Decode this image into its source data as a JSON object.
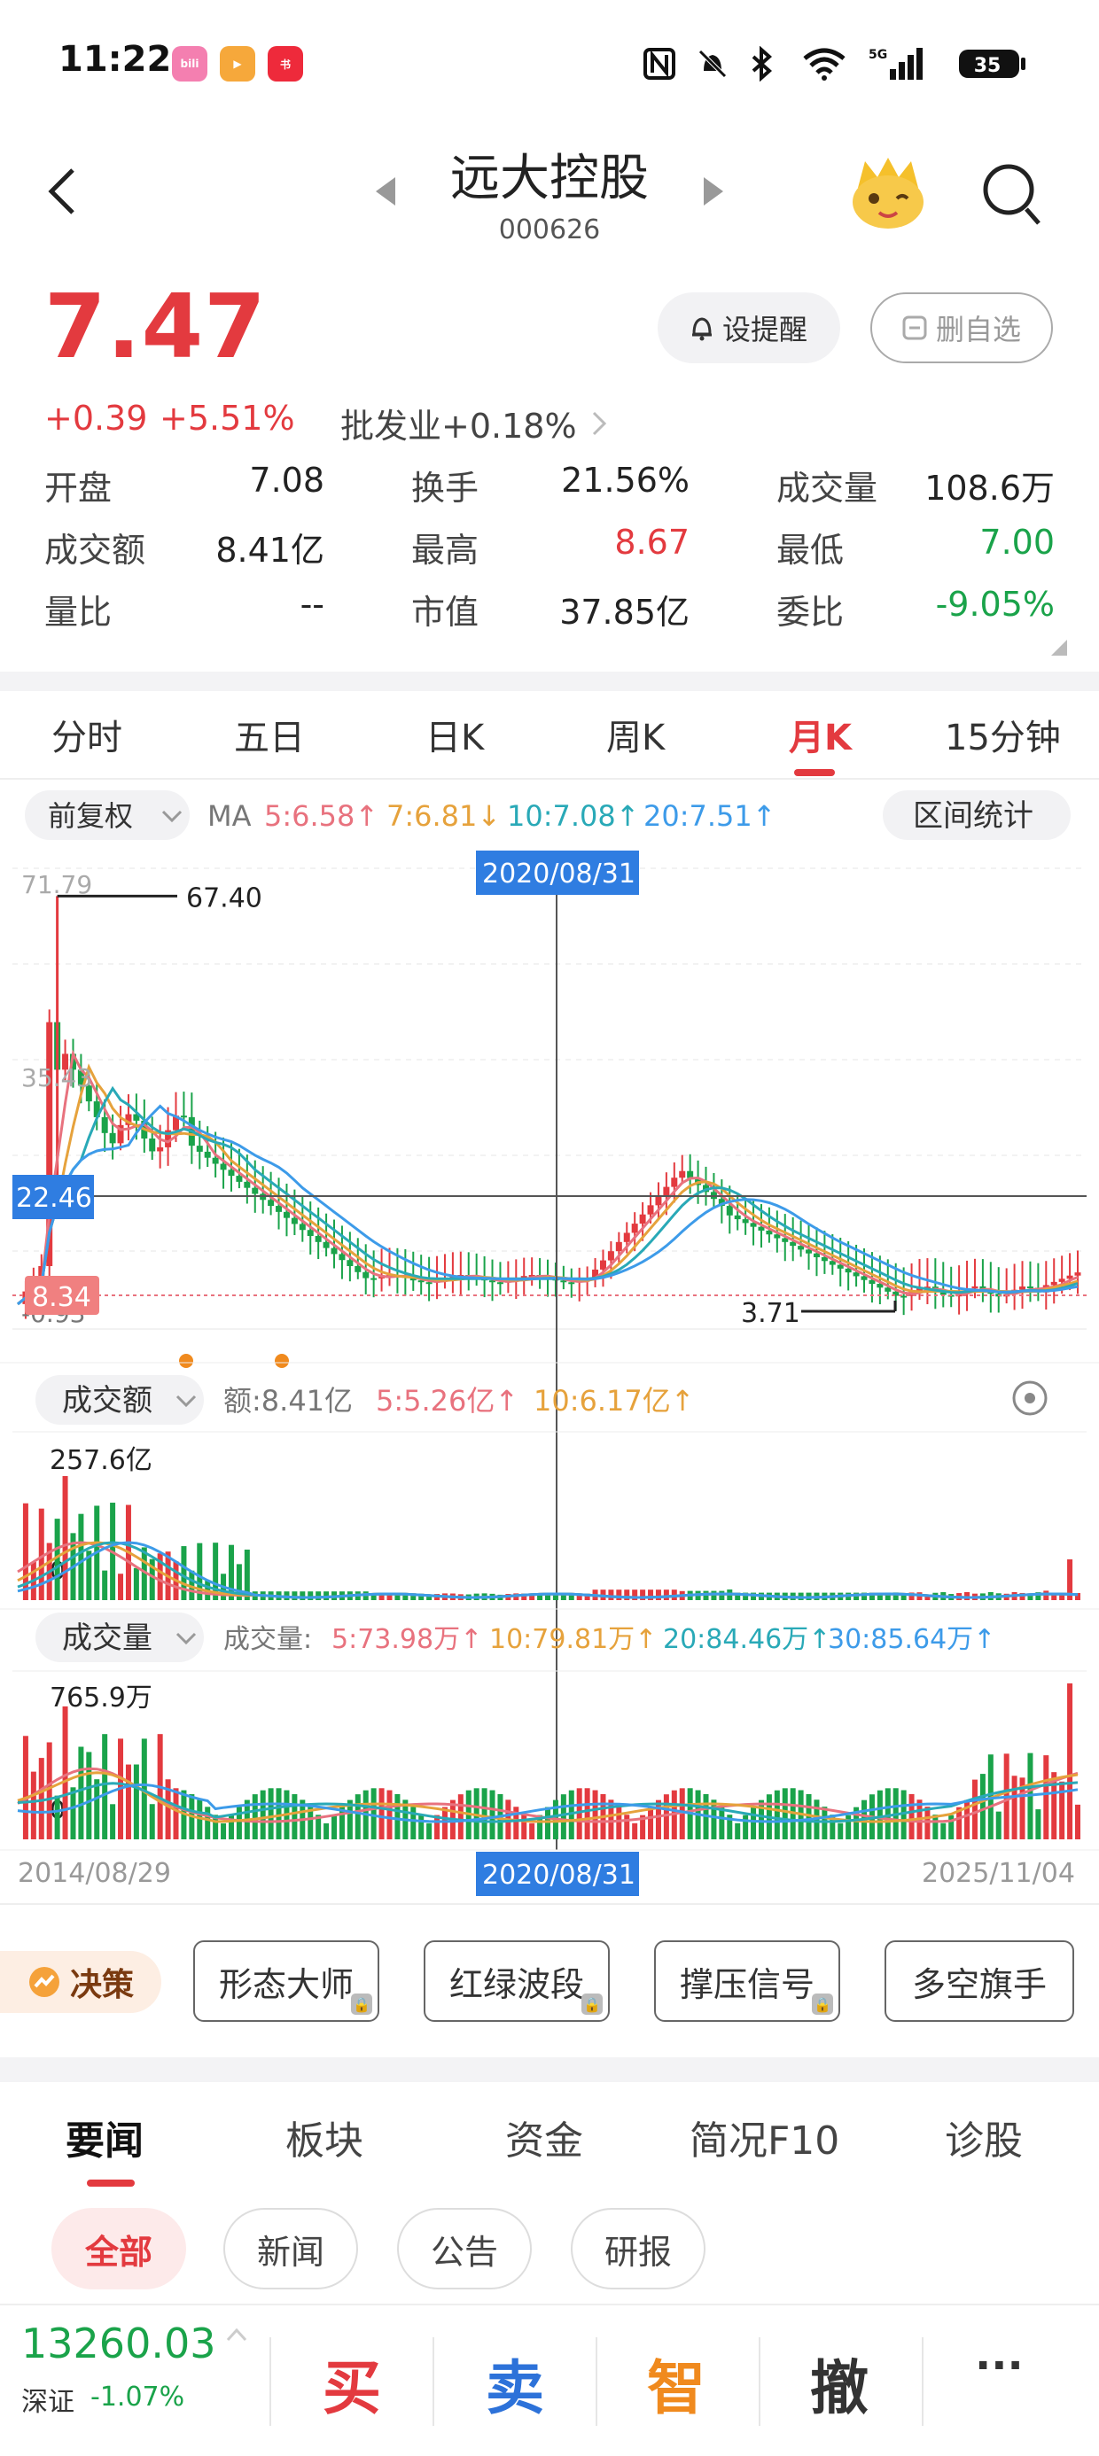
{
  "status_bar": {
    "time": "11:22",
    "apps": [
      "bilibili",
      "腾讯视频",
      "小红书"
    ],
    "battery": "35"
  },
  "header": {
    "title": "远大控股",
    "code": "000626"
  },
  "quote": {
    "price": "7.47",
    "change": "+0.39",
    "change_pct": "+5.51%",
    "sector": "批发业+0.18%",
    "remind_label": "设提醒",
    "remove_label": "删自选",
    "rows": [
      [
        {
          "k": "开盘",
          "v": "7.08"
        },
        {
          "k": "换手",
          "v": "21.56%"
        },
        {
          "k": "成交量",
          "v": "108.6万"
        }
      ],
      [
        {
          "k": "成交额",
          "v": "8.41亿"
        },
        {
          "k": "最高",
          "v": "8.67"
        },
        {
          "k": "最低",
          "v": "7.00"
        }
      ],
      [
        {
          "k": "量比",
          "v": "--"
        },
        {
          "k": "市值",
          "v": "37.85亿"
        },
        {
          "k": "委比",
          "v": "-9.05%"
        }
      ]
    ]
  },
  "period_tabs": [
    "分时",
    "五日",
    "日K",
    "周K",
    "月K",
    "15分钟"
  ],
  "active_tab": "月K",
  "chart_data": {
    "type": "candlestick",
    "adjust_label": "前复权",
    "ma_label": "MA",
    "ma": [
      {
        "name": "5",
        "value": "6.58",
        "color": "#e8727e"
      },
      {
        "name": "7",
        "value": "6.81",
        "color": "#e6a23c"
      },
      {
        "name": "10",
        "value": "7.08",
        "color": "#29a9b7"
      },
      {
        "name": "20",
        "value": "7.51",
        "color": "#3d9be9"
      }
    ],
    "interval_stats_label": "区间统计",
    "y_ticks": [
      "71.79",
      "35.43",
      "-0.93"
    ],
    "crosshair_price": "22.46",
    "current_price_label": "8.34",
    "max_label": "67.40",
    "min_label": "3.71",
    "crosshair_date": "2020/08/31",
    "start_date": "2014/08/29",
    "end_date": "2025/11/04",
    "amount_panel": {
      "selector": "成交额",
      "label_prefix": "额:",
      "value": "8.41亿",
      "ma5": "5:5.26亿",
      "ma10": "10:6.17亿",
      "top_tick": "257.6亿",
      "zero_tick": "0"
    },
    "volume_panel": {
      "selector": "成交量",
      "label_prefix": "成交量:",
      "ma5": "5:73.98万",
      "ma10": "10:79.81万",
      "ma20": "20:84.46万",
      "ma30": "30:85.64万",
      "top_tick": "765.9万",
      "zero_tick": "0"
    },
    "ylim": [
      -0.93,
      71.79
    ]
  },
  "tools": {
    "decision_label": "决策",
    "buttons": [
      "形态大师",
      "红绿波段",
      "撑压信号",
      "多空旗手"
    ]
  },
  "news_tabs": [
    "要闻",
    "板块",
    "资金",
    "简况F10",
    "诊股"
  ],
  "news_filters": [
    "全部",
    "新闻",
    "公告",
    "研报"
  ],
  "bottom": {
    "index_value": "13260.03",
    "index_name": "深证",
    "index_change": "-1.07%",
    "buy": "买",
    "sell": "卖",
    "smart": "智",
    "cancel": "撤",
    "more": "···"
  }
}
